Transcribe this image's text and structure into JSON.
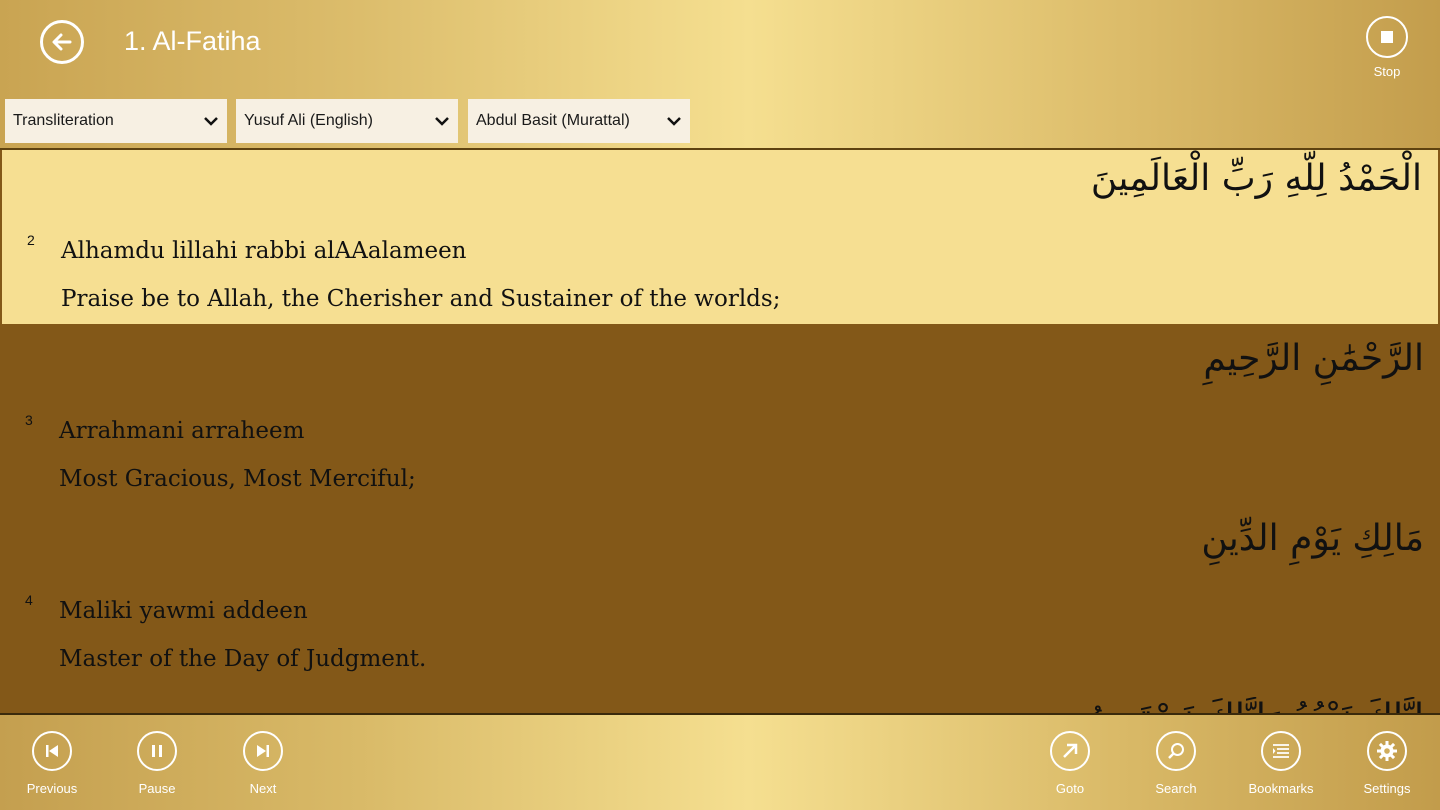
{
  "header": {
    "title": "1. Al-Fatiha",
    "back_icon": "back-arrow-icon",
    "stop_label": "Stop"
  },
  "dropdowns": {
    "text_mode": "Transliteration",
    "translation": "Yusuf Ali (English)",
    "reciter": "Abdul Basit (Murattal)"
  },
  "verses": [
    {
      "number": "2",
      "arabic": "الْحَمْدُ لِلَّهِ رَبِّ الْعَالَمِينَ",
      "transliteration": "Alhamdu lillahi rabbi alAAalameen",
      "translation": "Praise be to Allah, the Cherisher and Sustainer of the worlds;"
    },
    {
      "number": "3",
      "arabic": "الرَّحْمَٰنِ الرَّحِيمِ",
      "transliteration": "Arrahmani arraheem",
      "translation": "Most Gracious, Most Merciful;"
    },
    {
      "number": "4",
      "arabic": "مَالِكِ يَوْمِ الدِّينِ",
      "transliteration": "Maliki yawmi addeen",
      "translation": "Master of the Day of Judgment."
    }
  ],
  "partial_arabic": "إِيَّاكَ نَعْبُدُ وَإِيَّاكَ نَسْتَعِينُ",
  "footer": {
    "previous": "Previous",
    "pause": "Pause",
    "next": "Next",
    "goto": "Goto",
    "search": "Search",
    "bookmarks": "Bookmarks",
    "settings": "Settings"
  },
  "colors": {
    "selected_verse_bg": "#f6df92",
    "content_bg": "#835818",
    "header_gold": "#f5df90"
  }
}
